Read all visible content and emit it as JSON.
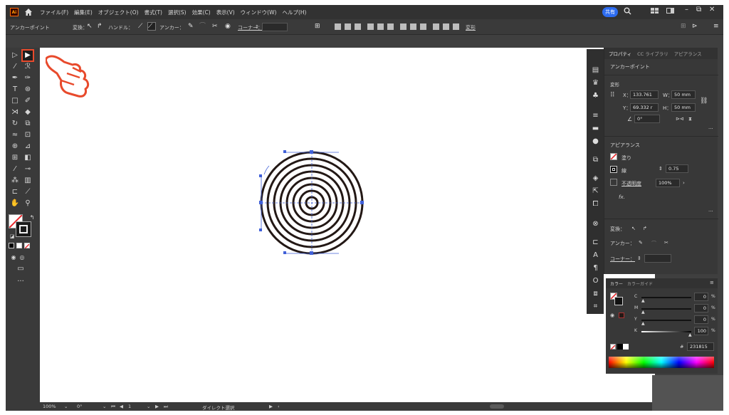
{
  "menubar": {
    "app_logo": "Ai",
    "home_icon": "home-icon",
    "menus": [
      "ファイル(F)",
      "編集(E)",
      "オブジェクト(O)",
      "書式(T)",
      "選択(S)",
      "効果(C)",
      "表示(V)",
      "ウィンドウ(W)",
      "ヘルプ(H)"
    ],
    "share_label": "共有",
    "window_controls": [
      "minimize-icon",
      "restore-icon",
      "close-icon"
    ]
  },
  "controlbar": {
    "selection_label": "アンカーポイント",
    "convert_label": "変換：",
    "handle_label": "ハンドル：",
    "anchor_label": "アンカー：",
    "corner_label": "コーナー：",
    "transform_label": "変形"
  },
  "properties": {
    "tabs": [
      "プロパティ",
      "CC ライブラリ",
      "アピアランス"
    ],
    "selection_type": "アンカーポイント",
    "transform_title": "変形",
    "x_label": "X：",
    "x_value": "133.761",
    "y_label": "Y：",
    "y_value": "69.332 r",
    "w_label": "W：",
    "w_value": "50 mm",
    "h_label": "H：",
    "h_value": "50 mm",
    "angle_value": "0°",
    "appearance_title": "アピアランス",
    "fill_label": "塗り",
    "stroke_label": "線",
    "stroke_value": "0.75",
    "opacity_label": "不透明度",
    "opacity_value": "100%",
    "fx_label": "fx.",
    "convert_label": "変換：",
    "anchor_label": "アンカー：",
    "corner_label": "コーナー："
  },
  "color_panel": {
    "tabs": [
      "カラー",
      "カラーガイド"
    ],
    "channels": [
      {
        "name": "C",
        "value": "0",
        "unit": "%"
      },
      {
        "name": "M",
        "value": "0",
        "unit": "%"
      },
      {
        "name": "Y",
        "value": "0",
        "unit": "%"
      },
      {
        "name": "K",
        "value": "100",
        "unit": "%"
      }
    ],
    "hex_prefix": "#",
    "hex_value": "231815"
  },
  "statusbar": {
    "zoom": "100%",
    "rotation": "0°",
    "artboard": "1",
    "tool_name": "ダイレクト選択"
  },
  "colors": {
    "accent": "#e84a2c",
    "share": "#2d6cf0",
    "ring_stroke": "#231815",
    "path_selection": "#4060d8"
  }
}
